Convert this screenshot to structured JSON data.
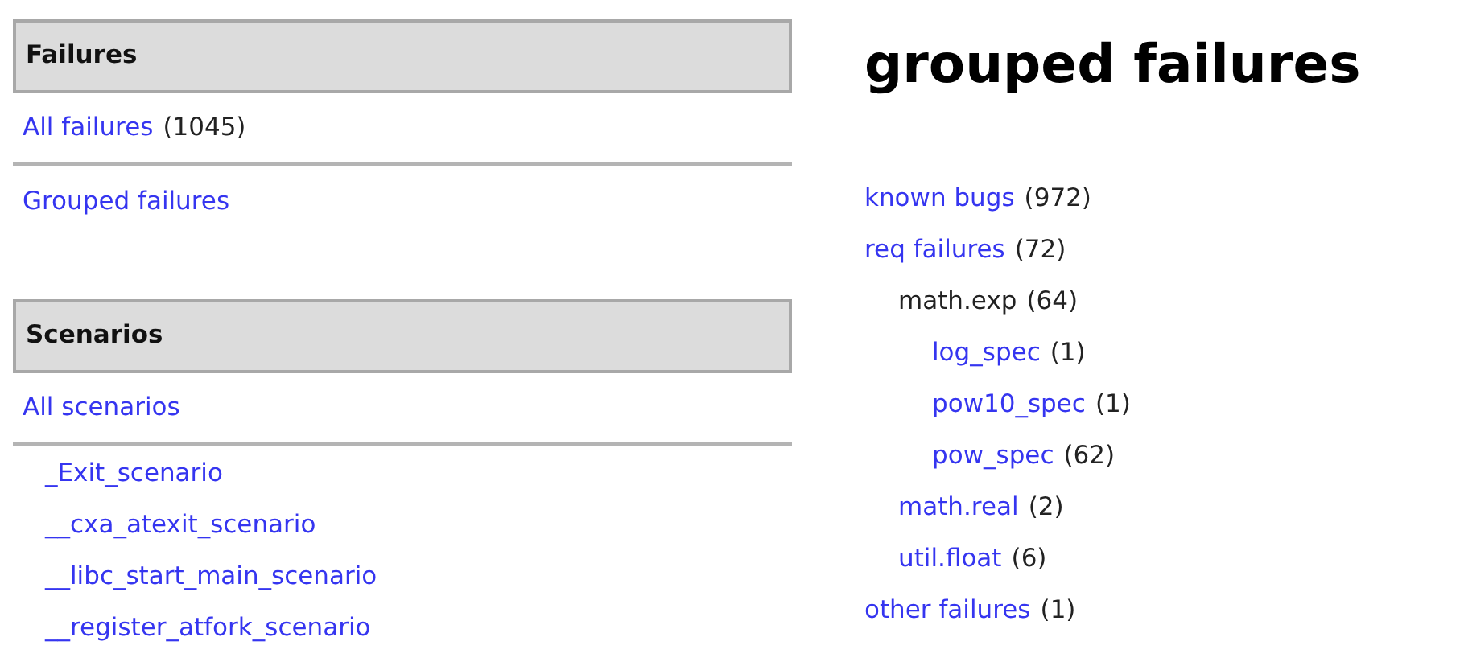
{
  "sidebar": {
    "sections": [
      {
        "title": "Failures",
        "links": [
          {
            "label": "All failures",
            "count": "(1045)"
          },
          {
            "label": "Grouped failures"
          }
        ]
      },
      {
        "title": "Scenarios",
        "links": [
          {
            "label": "All scenarios"
          }
        ],
        "sub_links": [
          {
            "label": "_Exit_scenario"
          },
          {
            "label": "__cxa_atexit_scenario"
          },
          {
            "label": "__libc_start_main_scenario"
          },
          {
            "label": "__register_atfork_scenario"
          }
        ]
      }
    ]
  },
  "main": {
    "title": "grouped failures",
    "groups": [
      {
        "kind": "link",
        "label": "known bugs",
        "count": "(972)"
      },
      {
        "kind": "link",
        "label": "req failures",
        "count": "(72)",
        "children": [
          {
            "kind": "text",
            "label": "math.exp",
            "count": "(64)",
            "children": [
              {
                "kind": "link",
                "label": "log_spec",
                "count": "(1)"
              },
              {
                "kind": "link",
                "label": "pow10_spec",
                "count": "(1)"
              },
              {
                "kind": "link",
                "label": "pow_spec",
                "count": "(62)"
              }
            ]
          },
          {
            "kind": "link",
            "label": "math.real",
            "count": "(2)"
          },
          {
            "kind": "link",
            "label": "util.float",
            "count": "(6)"
          }
        ]
      },
      {
        "kind": "link",
        "label": "other failures",
        "count": "(1)"
      }
    ]
  }
}
